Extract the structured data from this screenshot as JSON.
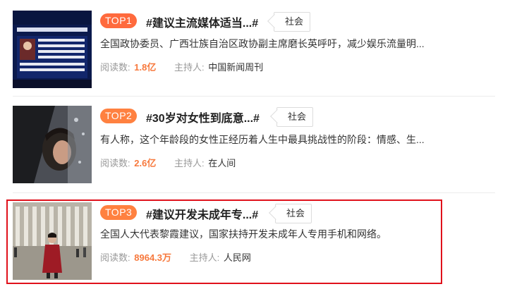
{
  "items": [
    {
      "rank": "TOP1",
      "title": "#建议主流媒体适当...#",
      "tag": "社会",
      "desc": "全国政协委员、广西壮族自治区政协副主席磨长英呼吁，减少娱乐流量明...",
      "reads_label": "阅读数:",
      "reads": "1.8亿",
      "host_label": "主持人:",
      "host": "中国新闻周刊"
    },
    {
      "rank": "TOP2",
      "title": "#30岁对女性到底意...#",
      "tag": "社会",
      "desc": "有人称，这个年龄段的女性正经历着人生中最具挑战性的阶段：情感、生...",
      "reads_label": "阅读数:",
      "reads": "2.6亿",
      "host_label": "主持人:",
      "host": "在人间"
    },
    {
      "rank": "TOP3",
      "title": "#建议开发未成年专...#",
      "tag": "社会",
      "desc": "全国人大代表黎霞建议，国家扶持开发未成年人专用手机和网络。",
      "reads_label": "阅读数:",
      "reads": "8964.3万",
      "host_label": "主持人:",
      "host": "人民网"
    }
  ],
  "colors": {
    "rank_badge": "#ff8140",
    "reads_number": "#f7793d",
    "highlight_box": "#e0111b"
  }
}
